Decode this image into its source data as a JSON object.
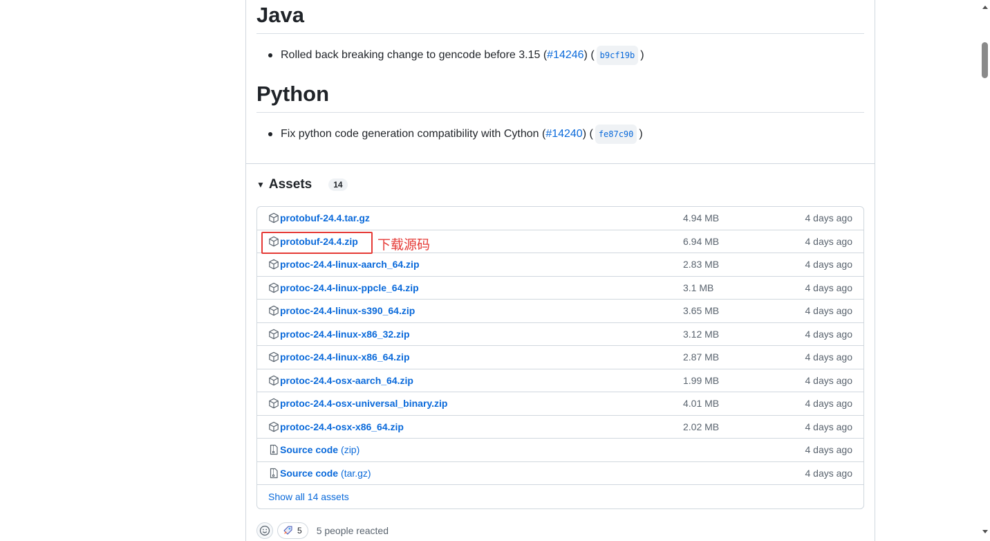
{
  "notes": {
    "java": {
      "title": "Java",
      "text": "Rolled back breaking change to gencode before 3.15 (",
      "pr": "#14246",
      "mid": ") (",
      "sha": "b9cf19b",
      "end": ")"
    },
    "python": {
      "title": "Python",
      "text": "Fix python code generation compatibility with Cython (",
      "pr": "#14240",
      "mid": ") (",
      "sha": "fe87c90",
      "end": ")"
    }
  },
  "assets": {
    "title": "Assets",
    "count": "14",
    "rows": [
      {
        "name": "protobuf-24.4.tar.gz",
        "size": "4.94 MB",
        "date": "4 days ago",
        "icon": "package-icon"
      },
      {
        "name": "protobuf-24.4.zip",
        "size": "6.94 MB",
        "date": "4 days ago",
        "icon": "package-icon"
      },
      {
        "name": "protoc-24.4-linux-aarch_64.zip",
        "size": "2.83 MB",
        "date": "4 days ago",
        "icon": "package-icon"
      },
      {
        "name": "protoc-24.4-linux-ppcle_64.zip",
        "size": "3.1 MB",
        "date": "4 days ago",
        "icon": "package-icon"
      },
      {
        "name": "protoc-24.4-linux-s390_64.zip",
        "size": "3.65 MB",
        "date": "4 days ago",
        "icon": "package-icon"
      },
      {
        "name": "protoc-24.4-linux-x86_32.zip",
        "size": "3.12 MB",
        "date": "4 days ago",
        "icon": "package-icon"
      },
      {
        "name": "protoc-24.4-linux-x86_64.zip",
        "size": "2.87 MB",
        "date": "4 days ago",
        "icon": "package-icon"
      },
      {
        "name": "protoc-24.4-osx-aarch_64.zip",
        "size": "1.99 MB",
        "date": "4 days ago",
        "icon": "package-icon"
      },
      {
        "name": "protoc-24.4-osx-universal_binary.zip",
        "size": "4.01 MB",
        "date": "4 days ago",
        "icon": "package-icon"
      },
      {
        "name": "protoc-24.4-osx-x86_64.zip",
        "size": "2.02 MB",
        "date": "4 days ago",
        "icon": "package-icon"
      }
    ],
    "source_rows": [
      {
        "name": "Source code",
        "ext": "(zip)",
        "date": "4 days ago",
        "icon": "file-zip-icon"
      },
      {
        "name": "Source code",
        "ext": "(tar.gz)",
        "date": "4 days ago",
        "icon": "file-zip-icon"
      }
    ],
    "show_all": "Show all 14 assets"
  },
  "annotation": {
    "text": "下载源码",
    "color": "#e53935"
  },
  "reactions": {
    "rocket_count": "5",
    "summary": "5 people reacted"
  },
  "colors": {
    "link": "#0969da",
    "muted": "#59636e",
    "border": "#d0d7de"
  }
}
